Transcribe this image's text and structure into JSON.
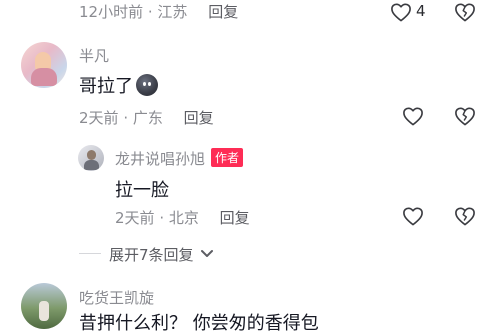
{
  "top_comment": {
    "time": "12小时前",
    "location": "江苏",
    "reply_label": "回复",
    "like_count": "4"
  },
  "comment1": {
    "username": "半凡",
    "text": "哥拉了",
    "emoji": "dark-ball-emoji",
    "time": "2天前",
    "location": "广东",
    "reply_label": "回复"
  },
  "reply1": {
    "username": "龙井说唱孙旭",
    "author_badge": "作者",
    "text": "拉一脸",
    "time": "2天前",
    "location": "北京",
    "reply_label": "回复"
  },
  "expand_label": "展开7条回复",
  "comment2": {
    "username": "吃货王凯旋",
    "text_partial": "昔押什么利？ 你尝匆的香得包"
  },
  "icons": {
    "like": "heart-outline-icon",
    "dislike": "broken-heart-icon",
    "expand": "chevron-down-icon"
  },
  "colors": {
    "author_badge": "#fe2c55",
    "meta_text": "#8a8b91",
    "body_text": "#161823"
  }
}
